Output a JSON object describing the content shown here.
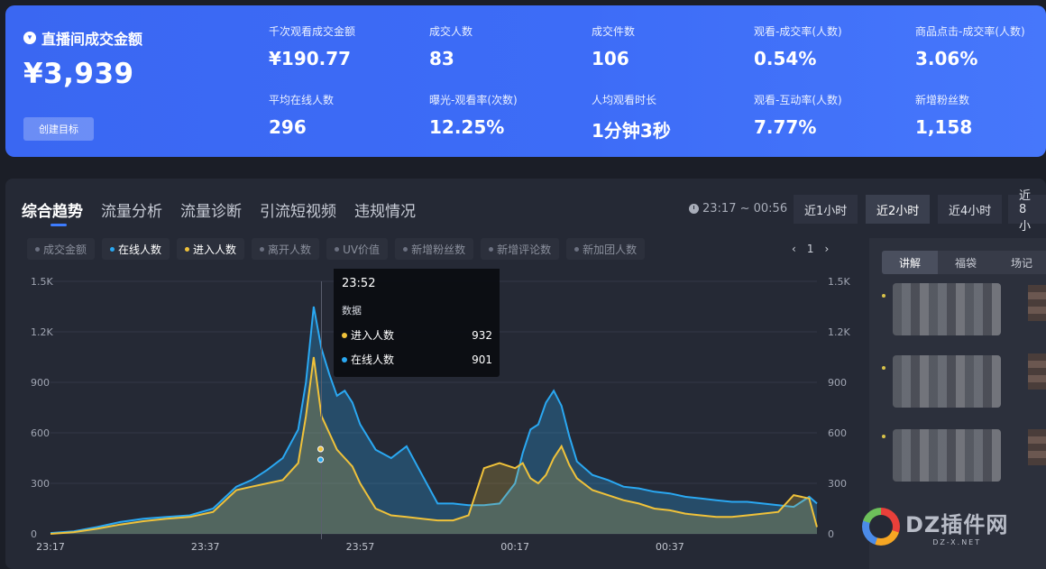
{
  "banner": {
    "gmv_title": "直播间成交金额",
    "gmv_value": "¥3,939",
    "goal_button": "创建目标",
    "metrics": [
      {
        "label": "千次观看成交金额",
        "value": "¥190.77"
      },
      {
        "label": "成交人数",
        "value": "83"
      },
      {
        "label": "成交件数",
        "value": "106"
      },
      {
        "label": "观看-成交率(人数)",
        "value": "0.54%"
      },
      {
        "label": "商品点击-成交率(人数)",
        "value": "3.06%"
      },
      {
        "label": "平均在线人数",
        "value": "296"
      },
      {
        "label": "曝光-观看率(次数)",
        "value": "12.25%"
      },
      {
        "label": "人均观看时长",
        "value": "1分钟3秒"
      },
      {
        "label": "观看-互动率(人数)",
        "value": "7.77%"
      },
      {
        "label": "新增粉丝数",
        "value": "1,158"
      }
    ]
  },
  "tabs": [
    "综合趋势",
    "流量分析",
    "流量诊断",
    "引流短视频",
    "违规情况"
  ],
  "time_range": "23:17 ~ 00:56",
  "periods": [
    "近1小时",
    "近2小时",
    "近4小时",
    "近8小"
  ],
  "legend": [
    {
      "label": "成交金额",
      "on": false
    },
    {
      "label": "在线人数",
      "on": true,
      "color": "#2aa8f2"
    },
    {
      "label": "进入人数",
      "on": true,
      "color": "#f0c23a"
    },
    {
      "label": "离开人数",
      "on": false
    },
    {
      "label": "UV价值",
      "on": false
    },
    {
      "label": "新增粉丝数",
      "on": false
    },
    {
      "label": "新增评论数",
      "on": false
    },
    {
      "label": "新加团人数",
      "on": false
    }
  ],
  "pager": {
    "prev": "‹",
    "page": "1",
    "next": "›"
  },
  "tooltip": {
    "time": "23:52",
    "section": "数据",
    "rows": [
      {
        "label": "进入人数",
        "value": "932",
        "color": "#f0c23a"
      },
      {
        "label": "在线人数",
        "value": "901",
        "color": "#2aa8f2"
      }
    ]
  },
  "side_tabs": [
    "讲解",
    "福袋",
    "场记"
  ],
  "watermark": {
    "text": "DZ插件网",
    "sub": "DZ-X.NET"
  },
  "chart_data": {
    "type": "area",
    "x_ticks": [
      "23:17",
      "23:37",
      "23:57",
      "00:17",
      "00:37"
    ],
    "y_ticks": [
      "0",
      "300",
      "600",
      "900",
      "1.2K",
      "1.5K"
    ],
    "ylim": [
      0,
      1500
    ],
    "x": [
      0,
      3,
      6,
      9,
      12,
      15,
      18,
      21,
      24,
      26,
      28,
      30,
      32,
      33,
      34,
      35,
      36,
      37,
      38,
      39,
      40,
      42,
      44,
      46,
      48,
      50,
      52,
      54,
      56,
      58,
      60,
      61,
      62,
      63,
      64,
      65,
      66,
      67,
      68,
      70,
      72,
      74,
      76,
      78,
      80,
      82,
      84,
      86,
      88,
      90,
      92,
      94,
      96,
      98,
      99
    ],
    "series": [
      {
        "name": "在线人数",
        "color": "#2aa8f2",
        "values": [
          5,
          15,
          40,
          70,
          90,
          100,
          110,
          150,
          280,
          320,
          380,
          450,
          620,
          900,
          1350,
          1100,
          950,
          820,
          850,
          780,
          650,
          500,
          450,
          520,
          350,
          180,
          180,
          170,
          170,
          180,
          300,
          480,
          620,
          650,
          780,
          850,
          760,
          580,
          430,
          350,
          320,
          280,
          270,
          250,
          240,
          220,
          210,
          200,
          190,
          190,
          180,
          170,
          160,
          220,
          180
        ]
      },
      {
        "name": "进入人数",
        "color": "#f0c23a",
        "values": [
          0,
          10,
          30,
          55,
          75,
          90,
          100,
          130,
          260,
          280,
          300,
          320,
          420,
          700,
          1050,
          700,
          600,
          500,
          450,
          400,
          300,
          150,
          110,
          100,
          90,
          80,
          80,
          110,
          390,
          420,
          390,
          420,
          330,
          300,
          350,
          450,
          520,
          410,
          330,
          260,
          230,
          200,
          180,
          150,
          140,
          120,
          110,
          100,
          100,
          110,
          120,
          130,
          230,
          210,
          40
        ]
      }
    ]
  }
}
